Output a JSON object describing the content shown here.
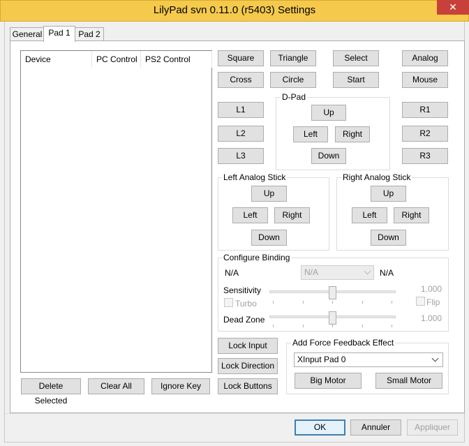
{
  "window": {
    "title": "LilyPad svn 0.11.0 (r5403) Settings",
    "close_glyph": "✕"
  },
  "tabs": [
    {
      "label": "General"
    },
    {
      "label": "Pad 1"
    },
    {
      "label": "Pad 2"
    }
  ],
  "binding_list": {
    "columns": [
      "Device",
      "PC Control",
      "PS2 Control"
    ],
    "rows": []
  },
  "list_buttons": {
    "delete_selected": "Delete Selected",
    "clear_all": "Clear All",
    "ignore_key": "Ignore Key"
  },
  "face_buttons": {
    "square": "Square",
    "triangle": "Triangle",
    "select": "Select",
    "analog": "Analog",
    "cross": "Cross",
    "circle": "Circle",
    "start": "Start",
    "mouse": "Mouse"
  },
  "shoulder": {
    "l1": "L1",
    "l2": "L2",
    "l3": "L3",
    "r1": "R1",
    "r2": "R2",
    "r3": "R3"
  },
  "dpad": {
    "title": "D-Pad",
    "up": "Up",
    "left": "Left",
    "right": "Right",
    "down": "Down"
  },
  "left_stick": {
    "title": "Left Analog Stick",
    "up": "Up",
    "left": "Left",
    "right": "Right",
    "down": "Down"
  },
  "right_stick": {
    "title": "Right Analog Stick",
    "up": "Up",
    "left": "Left",
    "right": "Right",
    "down": "Down"
  },
  "configure": {
    "title": "Configure Binding",
    "left_value": "N/A",
    "combo_value": "N/A",
    "right_value": "N/A",
    "sensitivity_label": "Sensitivity",
    "sensitivity_value": "1.000",
    "sensitivity_level": 0.5,
    "turbo_label": "Turbo",
    "flip_label": "Flip",
    "deadzone_label": "Dead Zone",
    "deadzone_value": "1.000",
    "deadzone_level": 0.5
  },
  "lock_buttons": {
    "input": "Lock Input",
    "direction": "Lock Direction",
    "buttons": "Lock Buttons"
  },
  "force_feedback": {
    "title": "Add Force Feedback Effect",
    "device": "XInput Pad 0",
    "big_motor": "Big Motor",
    "small_motor": "Small Motor"
  },
  "dialog": {
    "ok": "OK",
    "cancel": "Annuler",
    "apply": "Appliquer"
  }
}
